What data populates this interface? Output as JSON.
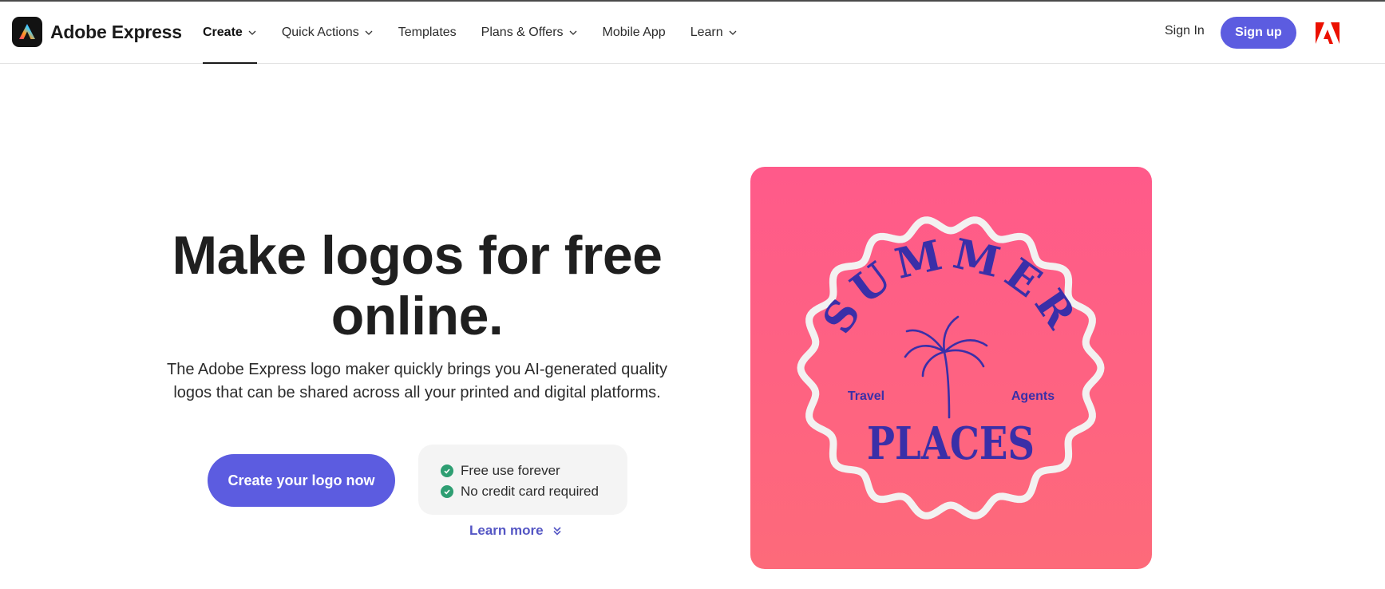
{
  "brand": {
    "name": "Adobe Express",
    "logo_icon": "adobe-express-logo-icon"
  },
  "nav": {
    "items": [
      {
        "label": "Create",
        "has_dropdown": true,
        "active": true
      },
      {
        "label": "Quick Actions",
        "has_dropdown": true,
        "active": false
      },
      {
        "label": "Templates",
        "has_dropdown": false,
        "active": false
      },
      {
        "label": "Plans & Offers",
        "has_dropdown": true,
        "active": false
      },
      {
        "label": "Mobile App",
        "has_dropdown": false,
        "active": false
      },
      {
        "label": "Learn",
        "has_dropdown": true,
        "active": false
      }
    ]
  },
  "account": {
    "sign_in": "Sign In",
    "sign_up": "Sign up",
    "adobe_icon": "adobe-a-icon"
  },
  "hero": {
    "title_line1": "Make logos for free",
    "title_line2": "online.",
    "description_line1": "The Adobe Express logo maker quickly brings you AI-generated quality",
    "description_line2": "logos that can be shared across all your printed and digital platforms.",
    "cta": "Create your logo now",
    "perks": [
      "Free use forever",
      "No credit card required"
    ],
    "learn_more": "Learn more"
  },
  "sample_logo": {
    "arc_text": "SUMMER",
    "left_text": "Travel",
    "right_text": "Agents",
    "bottom_text": "PLACES",
    "icon": "palm-tree-icon"
  },
  "colors": {
    "accent": "#5c5ce0",
    "link": "#5456c4",
    "check": "#2e9e72",
    "card_top": "#ff5a8a",
    "card_bottom": "#fd6a7a",
    "logo_ink": "#3a2fa8",
    "badge_outline": "#f3f1f1"
  }
}
